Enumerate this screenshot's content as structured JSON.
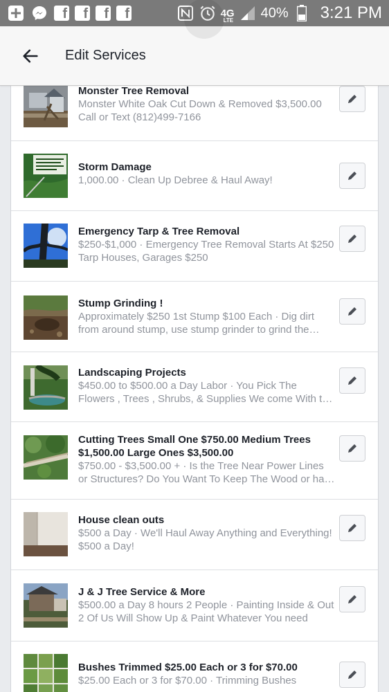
{
  "status_bar": {
    "battery": "40%",
    "time": "3:21 PM",
    "network": "4G",
    "network_sub": "LTE"
  },
  "header": {
    "title": "Edit Services",
    "back_icon": "arrow-left-icon"
  },
  "services": [
    {
      "title": "Monster Tree Removal",
      "description": "Monster White Oak Cut Down & Removed $3,500.00 Call or Text (812)499-7166"
    },
    {
      "title": "Storm Damage",
      "description": "1,000.00 · Clean Up Debree & Haul Away!"
    },
    {
      "title": "Emergency Tarp & Tree Removal",
      "description": "$250-$1,000 · Emergency Tree Removal Starts At $250 Tarp Houses, Garages $250"
    },
    {
      "title": "Stump Grinding !",
      "description": "Approximately $250 1st Stump $100 Each · Dig dirt from around stump, use stump grinder to grind the stump"
    },
    {
      "title": "Landscaping Projects",
      "description": "$450.00 to $500.00 a Day Labor · You Pick The Flowers , Trees , Shrubs, & Supplies We come With the tools"
    },
    {
      "title": "Cutting Trees Small One $750.00 Medium Trees $1,500.00 Large Ones $3,500.00",
      "description": "$750.00 - $3,500.00 + · Is the Tree Near Power Lines or Structures? Do You Want To Keep The Wood or have it hauled"
    },
    {
      "title": "House clean outs",
      "description": "$500 a Day · We'll Haul Away Anything and Everything! $500 a Day!"
    },
    {
      "title": "J & J Tree Service & More",
      "description": "$500.00 a Day 8 hours 2 People · Painting Inside & Out 2 Of Us Will Show Up & Paint Whatever You need"
    },
    {
      "title": "Bushes Trimmed $25.00 Each or 3 for $70.00",
      "description": "$25.00 Each or 3 for $70.00 · Trimming Bushes"
    }
  ],
  "edit_icon": "pencil-icon",
  "colors": {
    "status_bar": "#7a7a7a",
    "app_bar": "#f7f7f7",
    "page_bg": "#e9ebee",
    "title_text": "#1d2129",
    "secondary_text": "#90949c"
  }
}
